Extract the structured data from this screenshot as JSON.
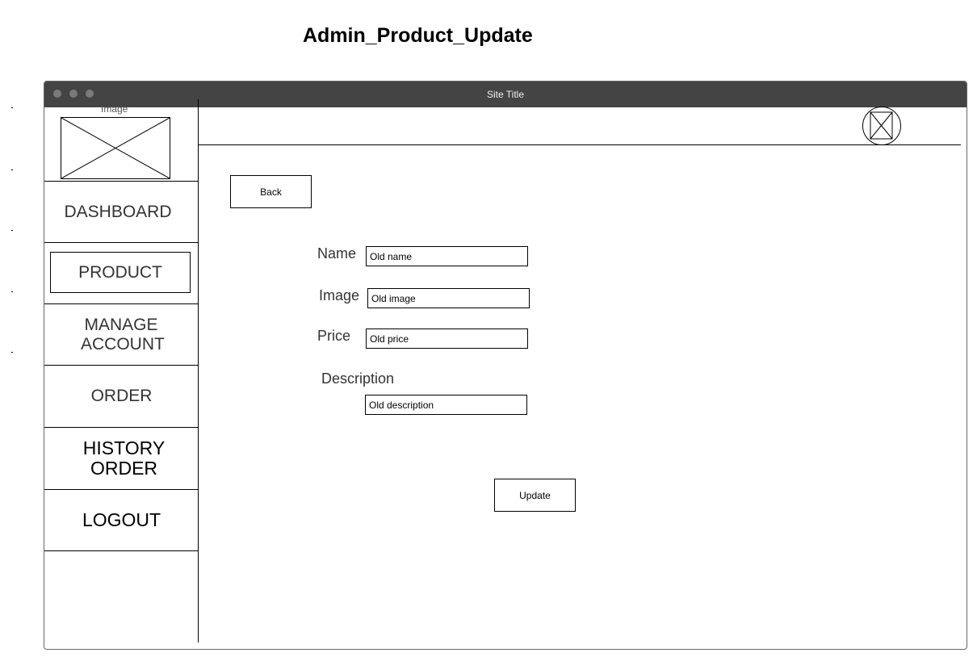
{
  "page_heading": "Admin_Product_Update",
  "window": {
    "title": "Site Title"
  },
  "sidebar": {
    "logo_caption": "Image",
    "items": [
      {
        "label": "DASHBOARD"
      },
      {
        "label": "PRODUCT"
      },
      {
        "label": "MANAGE ACCOUNT"
      },
      {
        "label": "ORDER"
      },
      {
        "label": "HISTORY ORDER"
      },
      {
        "label": "LOGOUT"
      }
    ],
    "active_item": "PRODUCT"
  },
  "header": {
    "avatar_icon": "image-placeholder-icon"
  },
  "main": {
    "back_label": "Back",
    "form": {
      "name_label": "Name",
      "name_value": "Old name",
      "image_label": "Image",
      "image_value": "Old image",
      "price_label": "Price",
      "price_value": "Old price",
      "description_label": "Description",
      "description_value": "Old description"
    },
    "update_label": "Update"
  }
}
